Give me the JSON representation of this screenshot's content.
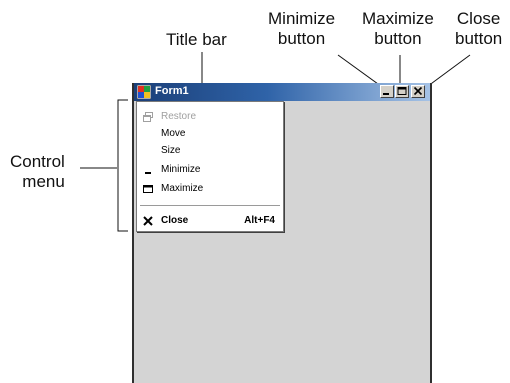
{
  "callouts": {
    "title_bar": "Title bar",
    "minimize_line1": "Minimize",
    "minimize_line2": "button",
    "maximize_line1": "Maximize",
    "maximize_line2": "button",
    "close_line1": "Close",
    "close_line2": "button",
    "control_line1": "Control",
    "control_line2": "menu"
  },
  "window": {
    "title": "Form1",
    "caption_buttons": {
      "minimize_icon": "minimize-icon",
      "maximize_icon": "maximize-icon",
      "close_icon": "close-icon"
    }
  },
  "control_menu": {
    "items": [
      {
        "label": "Restore",
        "icon": "restore-icon",
        "enabled": false
      },
      {
        "label": "Move",
        "icon": "",
        "enabled": true
      },
      {
        "label": "Size",
        "icon": "",
        "enabled": true
      },
      {
        "label": "Minimize",
        "icon": "minimize-icon",
        "enabled": true
      },
      {
        "label": "Maximize",
        "icon": "maximize-icon",
        "enabled": true
      },
      {
        "label": "Close",
        "shortcut": "Alt+F4",
        "icon": "close-icon",
        "enabled": true
      }
    ]
  },
  "colors": {
    "titlebar_start": "#1b3f78",
    "titlebar_end": "#a6c3e6",
    "client_area": "#d4d4d4",
    "menu_background": "#ffffff",
    "disabled_text": "#a0a0a0"
  }
}
